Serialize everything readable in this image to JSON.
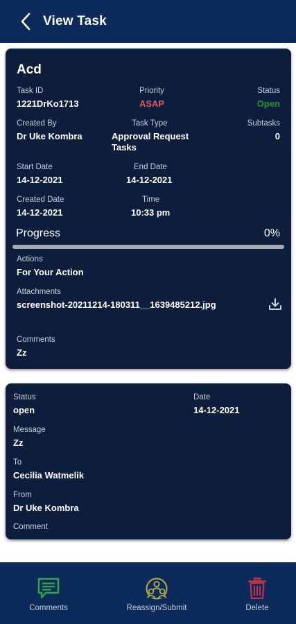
{
  "header": {
    "title": "View Task",
    "back_icon": "chevron-left-icon"
  },
  "task": {
    "name": "Acd",
    "task_id_label": "Task ID",
    "task_id": "1221DrKo1713",
    "priority_label": "Priority",
    "priority": "ASAP",
    "status_label": "Status",
    "status": "Open",
    "created_by_label": "Created By",
    "created_by": "Dr Uke Kombra",
    "task_type_label": "Task Type",
    "task_type_line1": "Approval Request",
    "task_type_line2": "Tasks",
    "subtasks_label": "Subtasks",
    "subtasks": "0",
    "start_date_label": "Start Date",
    "start_date": "14-12-2021",
    "end_date_label": "End Date",
    "end_date": "14-12-2021",
    "created_date_label": "Created Date",
    "created_date": "14-12-2021",
    "time_label": "Time",
    "time": "10:33 pm",
    "progress_label": "Progress",
    "progress_text": "0%",
    "progress_value": 0,
    "actions_label": "Actions",
    "actions": "For Your Action",
    "attachments_label": "Attachments",
    "attachment_name": "screenshot-20211214-180311__1639485212.jpg",
    "comments_label": "Comments",
    "comments": "Zz"
  },
  "history": {
    "status_label": "Status",
    "status": "open",
    "date_label": "Date",
    "date": "14-12-2021",
    "message_label": "Message",
    "message": "Zz",
    "to_label": "To",
    "to": "Cecilia Watmelik",
    "from_label": "From",
    "from": "Dr Uke Kombra",
    "comment_label": "Comment"
  },
  "bottom_nav": [
    {
      "label": "Comments",
      "icon": "comment-icon"
    },
    {
      "label": "Reassign/Submit",
      "icon": "group-icon"
    },
    {
      "label": "Delete",
      "icon": "trash-icon"
    }
  ],
  "colors": {
    "header_bg": "#0c2a5a",
    "card_bg": "#0d1e3d",
    "priority": "#e0585f",
    "status_open": "#1a9a2c",
    "comments_icon": "#2fa84a",
    "reassign_icon": "#b7b049",
    "delete_icon": "#c53045"
  }
}
